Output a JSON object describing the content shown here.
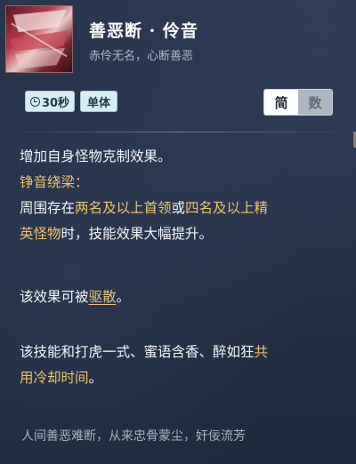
{
  "skill": {
    "name": "善恶断 · 伶音",
    "subtitle": "赤伶无名，心断善恶",
    "icon": "skill-art-icon"
  },
  "badges": {
    "cooldown": "30秒",
    "target": "单体"
  },
  "toggle": {
    "simple_label": "简",
    "numeric_label": "数",
    "selected": "简"
  },
  "description": {
    "line1": "增加自身怪物克制效果。",
    "section_title": "铮音绕梁：",
    "line3_a": "周围存在",
    "line3_b": "两名及以上首领",
    "line3_c": "或",
    "line3_d": "四名及以上精",
    "line4_a": "英怪物",
    "line4_b": "时，技能效果大幅提升。",
    "line5_a": "该效果可被",
    "line5_link": "驱散",
    "line5_c": "。",
    "line6_a": "该技能和打虎一式、蜜语含香、醉如狂",
    "line6_b": "共",
    "line7_a": "用冷却时间",
    "line7_b": "。"
  },
  "poem": "人间善恶难断，从来忠骨蒙尘，奸佞流芳",
  "colors": {
    "highlight": "#f0c36a",
    "background": "#25314a",
    "badge_bg": "#d6eef2"
  }
}
